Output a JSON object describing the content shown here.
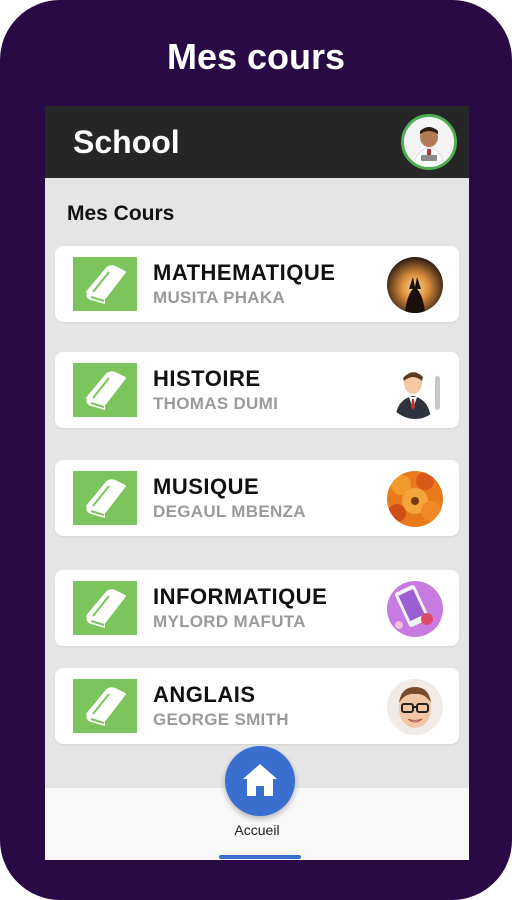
{
  "banner": {
    "title": "Mes cours"
  },
  "appbar": {
    "title": "School"
  },
  "section": {
    "title": "Mes Cours"
  },
  "courses": [
    {
      "name": "MATHEMATIQUE",
      "teacher": "MUSITA PHAKA"
    },
    {
      "name": "HISTOIRE",
      "teacher": "THOMAS DUMI"
    },
    {
      "name": "MUSIQUE",
      "teacher": "DEGAUL MBENZA"
    },
    {
      "name": "INFORMATIQUE",
      "teacher": "MYLORD MAFUTA"
    },
    {
      "name": "ANGLAIS",
      "teacher": "GEORGE  SMITH"
    }
  ],
  "bottom_nav": {
    "home_label": "Accueil"
  },
  "colors": {
    "frame": "#2a0a45",
    "appbar": "#262626",
    "accent_green": "#7cc55c",
    "accent_blue": "#3a6fd0"
  },
  "icons": {
    "course_icon": "book-icon",
    "home_icon": "home-icon"
  }
}
